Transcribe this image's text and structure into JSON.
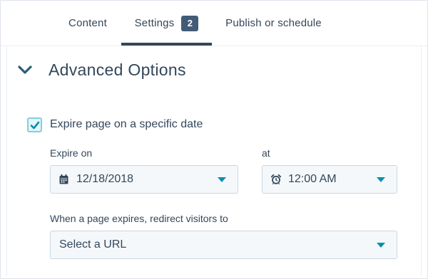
{
  "tabs": [
    {
      "label": "Content"
    },
    {
      "label": "Settings",
      "badge": "2"
    },
    {
      "label": "Publish or schedule"
    }
  ],
  "active_tab": "Settings",
  "section": {
    "title": "Advanced Options",
    "expanded": true
  },
  "expire": {
    "checkbox_label": "Expire page on a specific date",
    "checked": true,
    "date_label": "Expire on",
    "date_value": "12/18/2018",
    "time_label": "at",
    "time_value": "12:00 AM"
  },
  "redirect": {
    "label": "When a page expires, redirect visitors to",
    "placeholder": "Select a URL"
  },
  "colors": {
    "accent": "#0091ae",
    "text": "#33475b",
    "badge": "#425b76",
    "checkbox_border": "#7fd1de"
  },
  "icons": [
    "chevron-down-icon",
    "checkmark-icon",
    "calendar-icon",
    "alarm-clock-icon",
    "caret-down-icon"
  ]
}
